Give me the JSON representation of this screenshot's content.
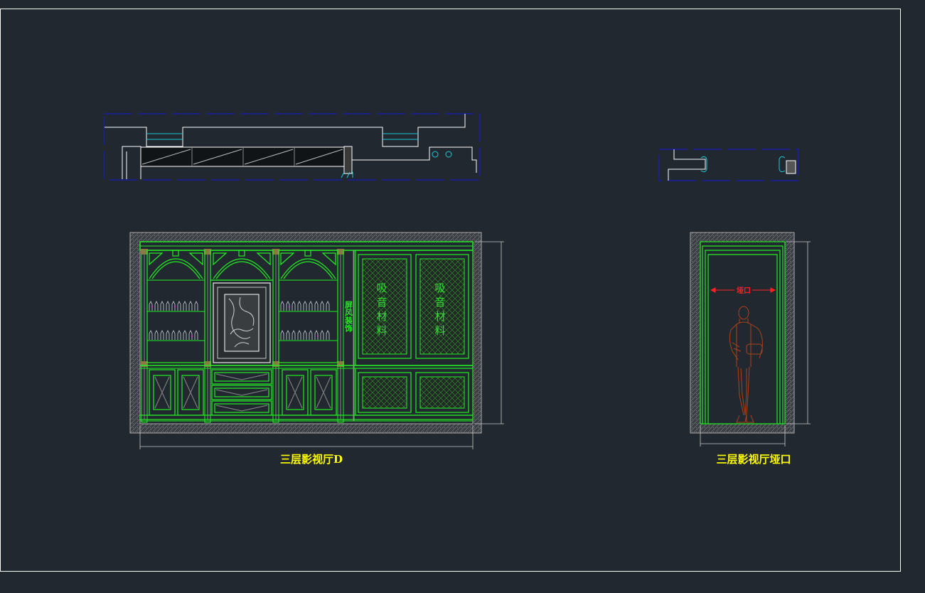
{
  "drawing": {
    "elevation_d_title": "三层影视厅D",
    "opening_title": "三层影视厅垭口",
    "panel_left_text": [
      "吸",
      "音",
      "材",
      "料"
    ],
    "panel_right_text": [
      "吸",
      "音",
      "材",
      "料"
    ],
    "side_vertical_text": "屏风装饰",
    "opening_dim_text": "垭口"
  },
  "colors": {
    "background": "#212830",
    "frame": "#ffffff",
    "green": "#22ee22",
    "blue": "#1010d0",
    "cyan": "#20c8d8",
    "hatch": "#8c8c8c",
    "dim": "#c8c8c8",
    "label": "#ffff00",
    "red": "#ff2020",
    "figure": "#b04018"
  }
}
